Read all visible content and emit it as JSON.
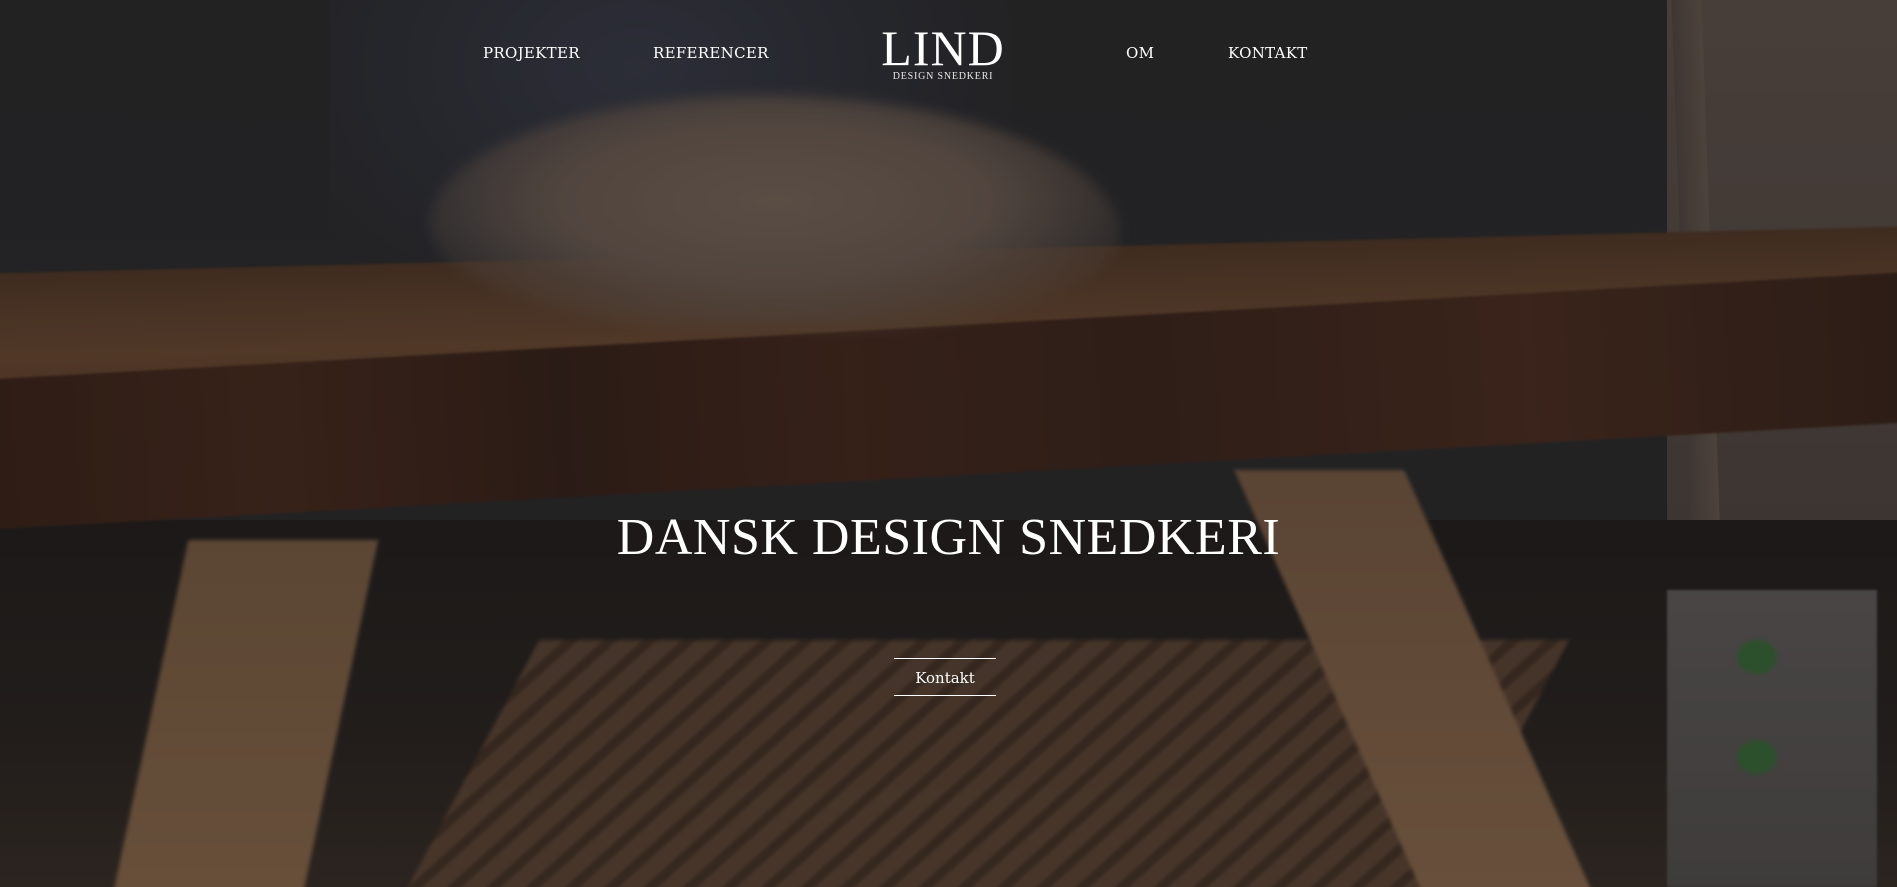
{
  "nav": {
    "items": [
      {
        "label": "PROJEKTER"
      },
      {
        "label": "REFERENCER"
      },
      {
        "label": "OM"
      },
      {
        "label": "KONTAKT"
      }
    ]
  },
  "logo": {
    "main": "LIND",
    "sub": "DESIGN SNEDKERI"
  },
  "hero": {
    "title": "DANSK DESIGN SNEDKERI",
    "button_label": "Kontakt"
  },
  "colors": {
    "text": "#ffffff",
    "overlay": "#181616"
  }
}
